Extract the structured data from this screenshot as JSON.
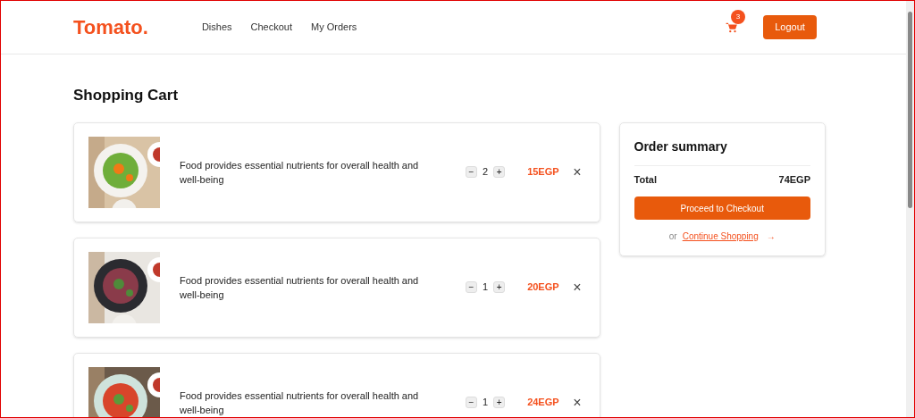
{
  "header": {
    "logo": "Tomato.",
    "nav": [
      {
        "label": "Dishes"
      },
      {
        "label": "Checkout"
      },
      {
        "label": "My Orders"
      }
    ],
    "cart_count": "3",
    "logout": "Logout"
  },
  "title": "Shopping Cart",
  "items": [
    {
      "description": "Food provides essential nutrients for overall health and well-being",
      "minus": "−",
      "quantity": "2",
      "plus": "+",
      "price": "15EGP",
      "remove": "×"
    },
    {
      "description": "Food provides essential nutrients for overall health and well-being",
      "minus": "−",
      "quantity": "1",
      "plus": "+",
      "price": "20EGP",
      "remove": "×"
    },
    {
      "description": "Food provides essential nutrients for overall health and well-being",
      "minus": "−",
      "quantity": "1",
      "plus": "+",
      "price": "24EGP",
      "remove": "×"
    }
  ],
  "summary": {
    "title": "Order summary",
    "total_label": "Total",
    "total": "74EGP",
    "checkout": "Proceed to Checkout",
    "or": "or",
    "continue": "Continue Shopping",
    "arrow": "→"
  }
}
